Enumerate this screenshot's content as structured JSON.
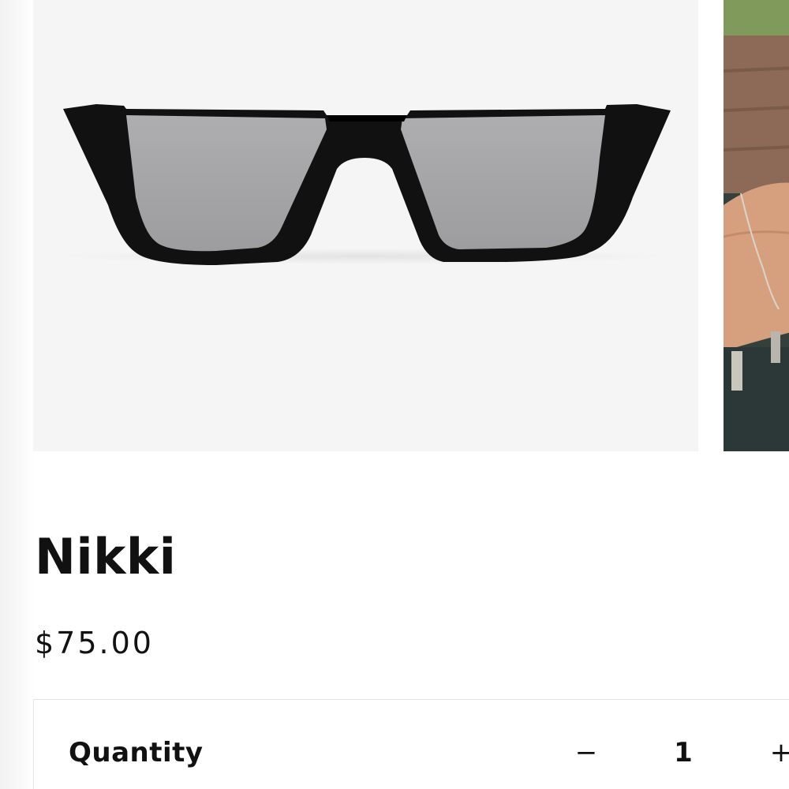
{
  "product": {
    "name": "Nikki",
    "price": "$75.00"
  },
  "gallery": {
    "main_image": "sunglasses-product-photo",
    "next_image": "model-wearing-sunglasses-photo"
  },
  "quantity": {
    "label": "Quantity",
    "decrease_symbol": "−",
    "value": "1",
    "increase_symbol": "+"
  },
  "colors": {
    "image_background": "#f5f5f5",
    "text": "#111111",
    "border": "#e4e4e4",
    "lens": "#a9a8aa",
    "frame": "#111111"
  }
}
